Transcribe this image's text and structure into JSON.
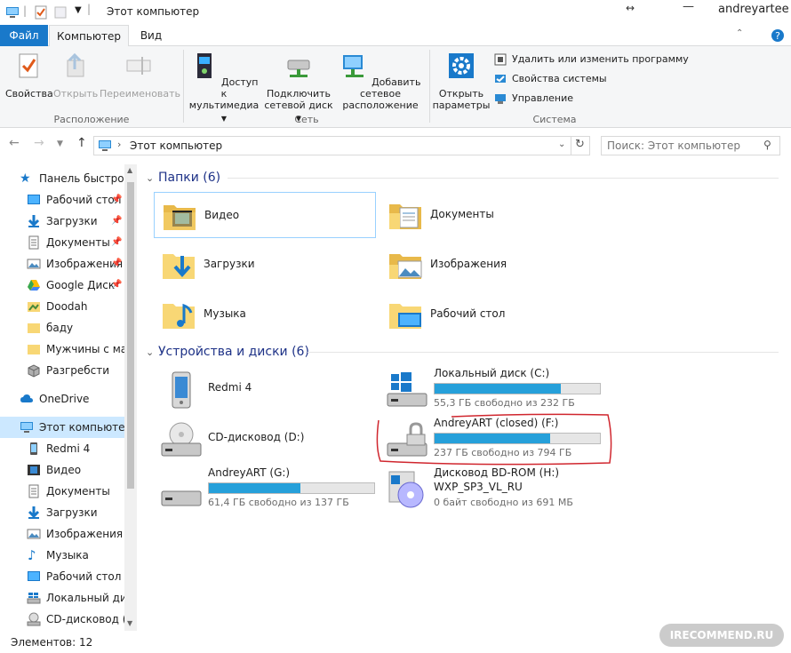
{
  "titlebar": {
    "title": "Этот компьютер",
    "user": "andreyartee"
  },
  "tabs": {
    "file": "Файл",
    "computer": "Компьютер",
    "view": "Вид"
  },
  "ribbon": {
    "properties": "Свойства",
    "open": "Открыть",
    "rename": "Переименовать",
    "group_location": "Расположение",
    "media_access_1": "Доступ к",
    "media_access_2": "мультимедиа",
    "map_drive_1": "Подключить",
    "map_drive_2": "сетевой диск",
    "add_network_1": "Добавить сетевое",
    "add_network_2": "расположение",
    "group_network": "Сеть",
    "open_settings_1": "Открыть",
    "open_settings_2": "параметры",
    "uninstall": "Удалить или изменить программу",
    "system_props": "Свойства системы",
    "manage": "Управление",
    "group_system": "Система"
  },
  "address": {
    "path": "Этот компьютер",
    "search_placeholder": "Поиск: Этот компьютер"
  },
  "sidebar": {
    "items": [
      {
        "label": "Панель быстрого доступа",
        "icon": "star-icon",
        "pinned": false
      },
      {
        "label": "Рабочий стол",
        "icon": "desktop-icon",
        "pinned": true
      },
      {
        "label": "Загрузки",
        "icon": "download-arrow-icon",
        "pinned": true
      },
      {
        "label": "Документы",
        "icon": "document-icon",
        "pinned": true
      },
      {
        "label": "Изображения",
        "icon": "image-icon",
        "pinned": true
      },
      {
        "label": "Google Диск",
        "icon": "google-drive-icon",
        "pinned": true
      },
      {
        "label": "Doodah",
        "icon": "folder-icon",
        "pinned": false
      },
      {
        "label": "баду",
        "icon": "folder-icon",
        "pinned": false
      },
      {
        "label": "Мужчины с марса",
        "icon": "folder-icon",
        "pinned": false
      },
      {
        "label": "Разгребсти",
        "icon": "box-icon",
        "pinned": false
      },
      {
        "label": "OneDrive",
        "icon": "cloud-icon",
        "pinned": false
      },
      {
        "label": "Этот компьютер",
        "icon": "computer-icon",
        "pinned": false
      },
      {
        "label": "Redmi 4",
        "icon": "phone-icon",
        "pinned": false
      },
      {
        "label": "Видео",
        "icon": "video-icon",
        "pinned": false
      },
      {
        "label": "Документы",
        "icon": "document-icon",
        "pinned": false
      },
      {
        "label": "Загрузки",
        "icon": "download-arrow-icon",
        "pinned": false
      },
      {
        "label": "Изображения",
        "icon": "image-icon",
        "pinned": false
      },
      {
        "label": "Музыка",
        "icon": "music-note-icon",
        "pinned": false
      },
      {
        "label": "Рабочий стол",
        "icon": "desktop-icon",
        "pinned": false
      },
      {
        "label": "Локальный диск (C:)",
        "icon": "windows-drive-icon",
        "pinned": false
      },
      {
        "label": "CD-дисковод (D:)",
        "icon": "cd-drive-icon",
        "pinned": false
      }
    ]
  },
  "folders": {
    "header": "Папки (6)",
    "items": [
      {
        "label": "Видео",
        "icon": "video-folder-icon"
      },
      {
        "label": "Документы",
        "icon": "documents-folder-icon"
      },
      {
        "label": "Загрузки",
        "icon": "downloads-folder-icon"
      },
      {
        "label": "Изображения",
        "icon": "pictures-folder-icon"
      },
      {
        "label": "Музыка",
        "icon": "music-folder-icon"
      },
      {
        "label": "Рабочий стол",
        "icon": "desktop-folder-icon"
      }
    ]
  },
  "devices": {
    "header": "Устройства и диски (6)",
    "items": [
      {
        "name": "Redmi 4",
        "icon": "phone-icon"
      },
      {
        "name": "Локальный диск (C:)",
        "icon": "windows-drive-icon",
        "free": "55,3 ГБ свободно из 232 ГБ",
        "used_fraction": 0.762
      },
      {
        "name": "CD-дисковод (D:)",
        "icon": "cd-drive-icon"
      },
      {
        "name": "AndreyART (closed) (F:)",
        "icon": "locked-drive-icon",
        "free": "237 ГБ свободно из 794 ГБ",
        "used_fraction": 0.701
      },
      {
        "name": "AndreyART (G:)",
        "icon": "drive-icon",
        "free": "61,4 ГБ свободно из 137 ГБ",
        "used_fraction": 0.552
      },
      {
        "name": "Дисковод BD-ROM (H:)",
        "name2": "WXP_SP3_VL_RU",
        "icon": "bd-rom-icon",
        "free": "0 байт свободно из 691 МБ"
      }
    ]
  },
  "status": {
    "count": "Элементов: 12"
  },
  "watermark": "IRECOMMEND.RU",
  "colors": {
    "accent": "#1979ca",
    "bar": "#26a0da",
    "highlight": "#cce8ff",
    "annotation": "#d0262e",
    "section_header": "#1e3287"
  }
}
